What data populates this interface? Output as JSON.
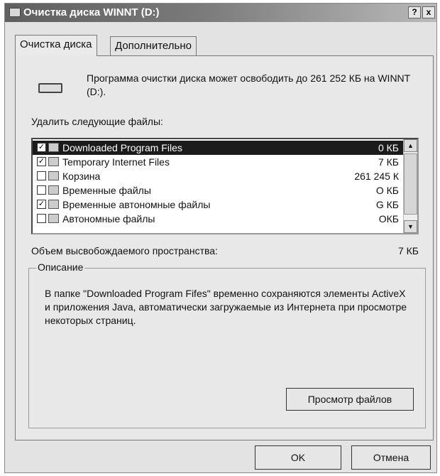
{
  "window": {
    "title": "Очистка диска WINNT (D:)"
  },
  "titlebar_buttons": {
    "help": "?",
    "close": "x"
  },
  "tabs": [
    {
      "label": "Очистка диска"
    },
    {
      "label": "Дополнительно"
    }
  ],
  "intro": {
    "text": "Программа очистки диска может освободить до 261 252 КБ на WINNT (D:)."
  },
  "files_label": "Удалить следующие файлы:",
  "file_list": [
    {
      "name": "Downloaded Program Files",
      "size": "0 КБ",
      "checked": true,
      "selected": true,
      "icon": "folder-icon"
    },
    {
      "name": "Temporary Internet Files",
      "size": "7 КБ",
      "checked": true,
      "selected": false,
      "icon": "folder-icon"
    },
    {
      "name": "Корзина",
      "size": "261 245 К",
      "checked": false,
      "selected": false,
      "icon": "recycle-bin-icon"
    },
    {
      "name": "Временные файлы",
      "size": "О КБ",
      "checked": false,
      "selected": false,
      "icon": "file-icon"
    },
    {
      "name": "Временные автономные файлы",
      "size": "G КБ",
      "checked": true,
      "selected": false,
      "icon": "offline-files-icon"
    },
    {
      "name": "Автономные файлы",
      "size": "ОКБ",
      "checked": false,
      "selected": false,
      "icon": "offline-files-icon"
    }
  ],
  "space": {
    "label": "Объем высвобождаемого пространства:",
    "value": "7 КБ"
  },
  "description": {
    "title": "Описание",
    "text": "В папке \"Downloaded Program Fifes\" временно сохраняются элементы ActiveX и приложения Java, автоматически загружаемые из Интернета при просмотре некоторых страниц."
  },
  "buttons": {
    "view_files": "Просмотр файлов",
    "ok": "OK",
    "cancel": "Отмена"
  },
  "colors": {
    "selected_row": "#1b1b1b",
    "window_bg": "#e3e3e3"
  }
}
